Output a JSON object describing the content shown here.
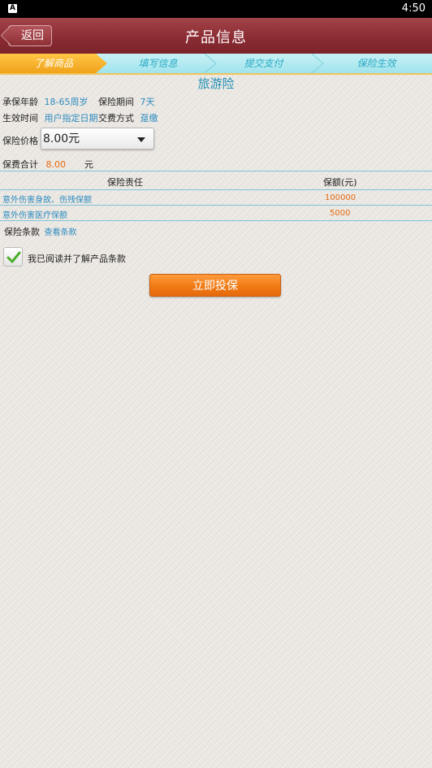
{
  "status_bar": {
    "notification_icon": "A",
    "time": "4:50"
  },
  "header": {
    "back_label": "返回",
    "title": "产品信息"
  },
  "steps": [
    {
      "label": "了解商品",
      "active": true
    },
    {
      "label": "填写信息",
      "active": false
    },
    {
      "label": "提交支付",
      "active": false
    },
    {
      "label": "保险生效",
      "active": false
    }
  ],
  "product": {
    "name": "旅游险",
    "age_label": "承保年龄",
    "age_value": "18-65周岁",
    "period_label": "保险期间",
    "period_value": "7天",
    "effective_label": "生效时间",
    "effective_value": "用户指定日期",
    "payment_label": "交费方式",
    "payment_value": "趸缴",
    "price_label": "保险价格",
    "price_selected": "8.00元",
    "total_label": "保费合计",
    "total_value": "8.00",
    "total_unit": "元"
  },
  "coverage_table": {
    "headers": [
      "保险责任",
      "保额(元)"
    ],
    "rows": [
      [
        "意外伤害身故、伤残保额",
        "100000"
      ],
      [
        "意外伤害医疗保额",
        "5000"
      ]
    ]
  },
  "terms": {
    "label": "保险条款",
    "link": "查看条款"
  },
  "agreement": {
    "label": "我已阅读并了解产品条款",
    "checked": true
  },
  "actions": {
    "submit_label": "立即投保"
  },
  "colors": {
    "header": "#8b2c33",
    "accent": "#f07a14",
    "link": "#2d8cc0",
    "step_active": "#f0a21a"
  }
}
